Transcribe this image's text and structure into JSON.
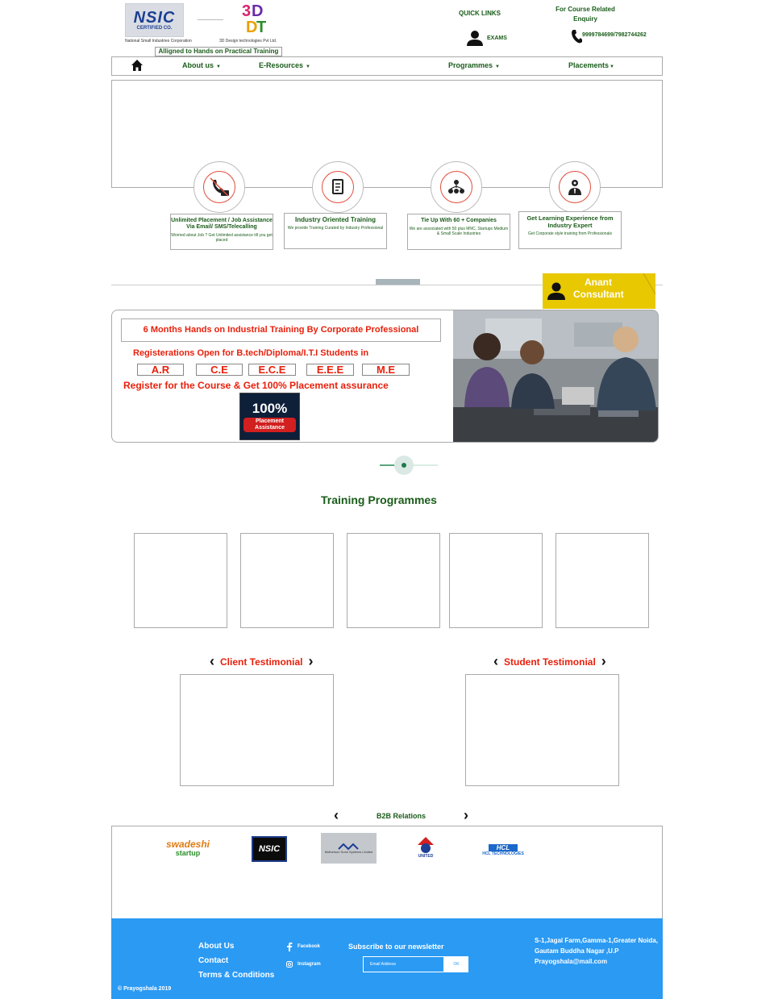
{
  "header": {
    "nsic_logo_text": "NSIC",
    "nsic_logo_sub": "CERTIFIED CO.",
    "nsic_caption": "National Small Industries Corporation",
    "ddd_caption": "3D Design technologies Pvt Ltd.",
    "tagline": "Alligned to Hands on Practical Training",
    "quick_links": "QUICK LINKS",
    "exams": "EXAMS",
    "enquiry": "For Course Related Enquiry",
    "phone": "9999784699/7982744262"
  },
  "nav": {
    "items": [
      {
        "label": "About us",
        "caret": "▼"
      },
      {
        "label": "E-Resources",
        "caret": "▼"
      },
      {
        "label": "Programmes",
        "caret": "▼"
      },
      {
        "label": "Placements",
        "caret": "▼"
      }
    ]
  },
  "features": [
    {
      "title": "Unlimited Placement / Job Assistance Via Email/ SMS/Telecalling",
      "desc": "Worried about Job ? Get Unlimited assistance till you get placed"
    },
    {
      "title": "Industry Oriented Training",
      "desc": "We provide Training Curated by Industry Professional"
    },
    {
      "title": "Tie Up With 60 + Companies",
      "desc": "We are associated with 50 plus MNC, Startups Medium & Small Scale Industries"
    },
    {
      "title": "Get Learning Experience from Industry Expert",
      "desc": "Get Corporate style training from Professionals"
    }
  ],
  "consultant": {
    "name": "Anant Consultant"
  },
  "promo": {
    "title": "6 Months Hands on Industrial Training By Corporate Professional",
    "registration": "Registerations Open for B.tech/Diploma/I.T.I Students in",
    "branches": [
      "A.R",
      "C.E",
      "E.C.E",
      "E.E.E",
      "M.E"
    ],
    "cta": "Register for the Course & Get 100% Placement assurance",
    "badge_number": "100%",
    "badge_text": "Placement Assistance"
  },
  "training": {
    "title": "Training Programmes"
  },
  "testimonials": {
    "client": "Client Testimonial",
    "student": "Student Testimonial"
  },
  "b2b": {
    "title": "B2B Relations",
    "logos": {
      "swadeshi": "swadeshi",
      "swadeshi_sub": "startup",
      "nsic": "NSIC",
      "motherson": "Motherson Sumi Systems Limited",
      "united": "UNITED",
      "hcl": "HCL",
      "hcl_sub": "HCL TECHNOLOGIES"
    }
  },
  "footer": {
    "links": [
      "About Us",
      "Contact",
      "Terms & Conditions"
    ],
    "facebook": "Facebook",
    "instagram": "Instagram",
    "subscribe": "Subscribe to our newsletter",
    "email_placeholder": "Email Address",
    "ok": "OK",
    "address": "S-1,Jagal Farm,Gamma-1,Greater Noida, Gautam Buddha Nagar ,U.P",
    "email": "Prayogshala@mail.com",
    "copyright": "© Prayogshala  2019"
  }
}
